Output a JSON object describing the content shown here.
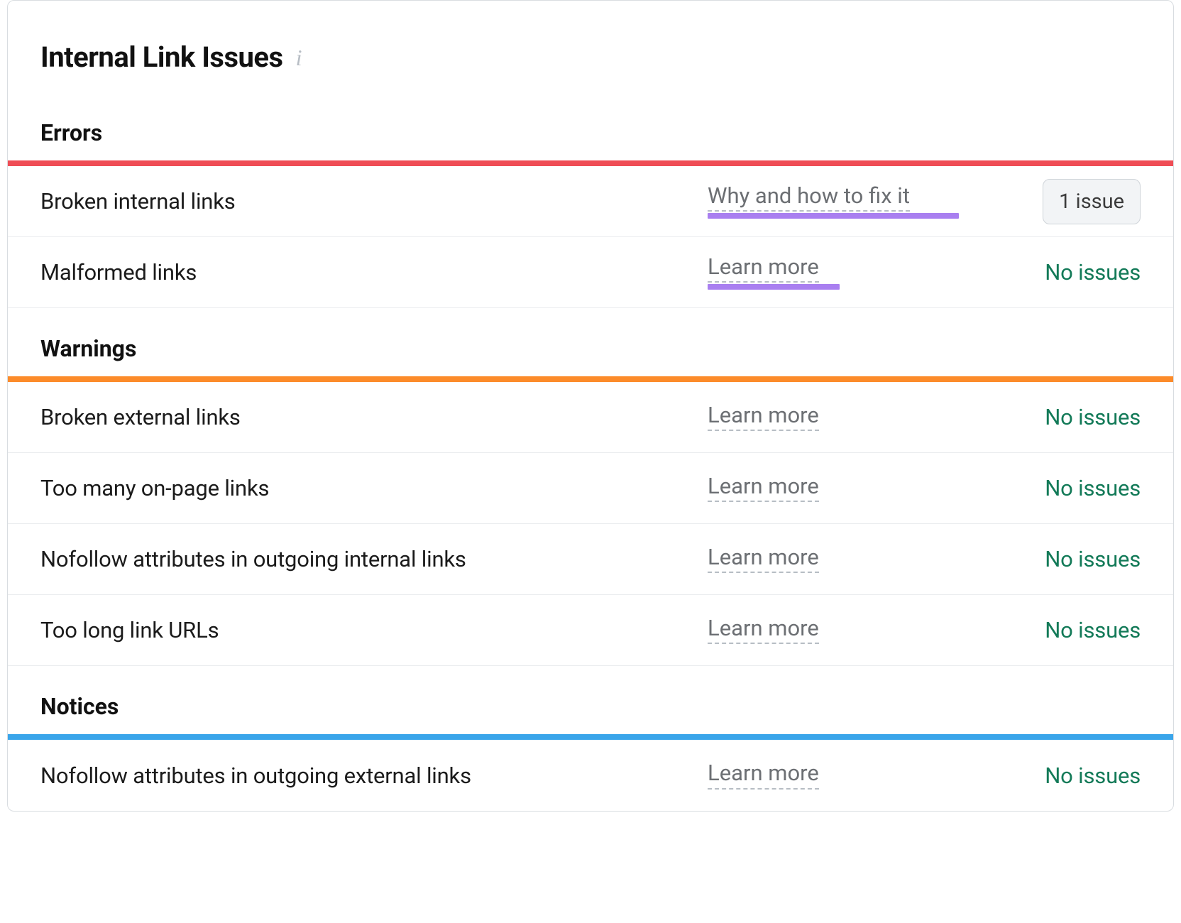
{
  "title": "Internal Link Issues",
  "colors": {
    "errors": "#ef4d55",
    "warnings": "#fc8b2a",
    "notices": "#3aa5ea",
    "highlight": "#a97ff0",
    "ok_text": "#137a58"
  },
  "status_no_issues": "No issues",
  "sections": {
    "errors": {
      "heading": "Errors",
      "rows": [
        {
          "label": "Broken internal links",
          "help": "Why and how to fix it",
          "highlight": true,
          "highlight_width": 354,
          "status_type": "count",
          "status_text": "1 issue"
        },
        {
          "label": "Malformed links",
          "help": "Learn more",
          "highlight": true,
          "highlight_width": 186,
          "status_type": "ok",
          "status_text": "No issues"
        }
      ]
    },
    "warnings": {
      "heading": "Warnings",
      "rows": [
        {
          "label": "Broken external links",
          "help": "Learn more",
          "highlight": false,
          "status_type": "ok",
          "status_text": "No issues"
        },
        {
          "label": "Too many on-page links",
          "help": "Learn more",
          "highlight": false,
          "status_type": "ok",
          "status_text": "No issues"
        },
        {
          "label": "Nofollow attributes in outgoing internal links",
          "help": "Learn more",
          "highlight": false,
          "status_type": "ok",
          "status_text": "No issues"
        },
        {
          "label": "Too long link URLs",
          "help": "Learn more",
          "highlight": false,
          "status_type": "ok",
          "status_text": "No issues"
        }
      ]
    },
    "notices": {
      "heading": "Notices",
      "rows": [
        {
          "label": "Nofollow attributes in outgoing external links",
          "help": "Learn more",
          "highlight": false,
          "status_type": "ok",
          "status_text": "No issues"
        }
      ]
    }
  }
}
